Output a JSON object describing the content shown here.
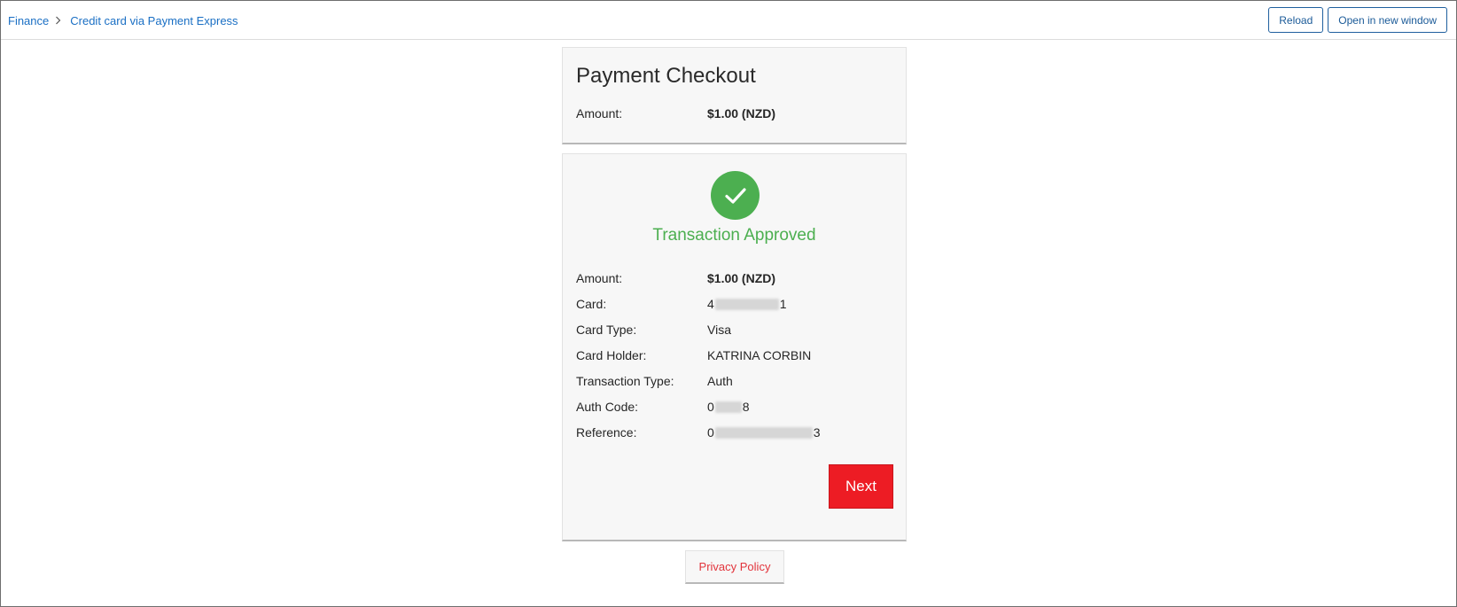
{
  "breadcrumb": {
    "items": [
      {
        "label": "Finance"
      },
      {
        "label": "Credit card via Payment Express"
      }
    ]
  },
  "toolbar": {
    "reload_label": "Reload",
    "open_new_window_label": "Open in new window"
  },
  "checkout": {
    "title": "Payment Checkout",
    "amount_label": "Amount:",
    "amount_value": "$1.00 (NZD)"
  },
  "transaction": {
    "status_icon": "checkmark-icon",
    "status_text": "Transaction Approved",
    "status_color": "#4caf50",
    "rows": [
      {
        "label": "Amount:",
        "value": "$1.00 (NZD)"
      },
      {
        "label": "Card:",
        "value_start": "4",
        "value_end": "1"
      },
      {
        "label": "Card Type:",
        "value": "Visa"
      },
      {
        "label": "Card Holder:",
        "value": "KATRINA CORBIN"
      },
      {
        "label": "Transaction Type:",
        "value": "Auth"
      },
      {
        "label": "Auth Code:",
        "value_start": "0",
        "value_end": "8"
      },
      {
        "label": "Reference:",
        "value_start": "0",
        "value_end": "3"
      }
    ],
    "next_label": "Next"
  },
  "footer": {
    "privacy_label": "Privacy Policy"
  },
  "colors": {
    "link": "#1a6fc4",
    "primary_button": "#ed1c24",
    "success": "#4caf50",
    "privacy_link": "#e2343c"
  }
}
